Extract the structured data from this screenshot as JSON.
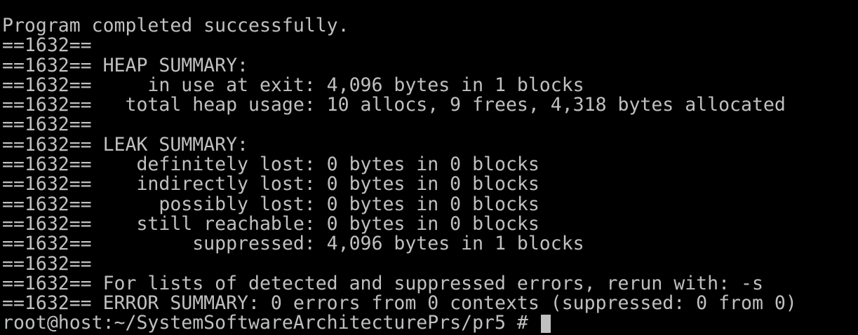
{
  "terminal": {
    "lines": [
      "Program completed successfully.",
      "==1632==",
      "==1632== HEAP SUMMARY:",
      "==1632==     in use at exit: 4,096 bytes in 1 blocks",
      "==1632==   total heap usage: 10 allocs, 9 frees, 4,318 bytes allocated",
      "==1632==",
      "==1632== LEAK SUMMARY:",
      "==1632==    definitely lost: 0 bytes in 0 blocks",
      "==1632==    indirectly lost: 0 bytes in 0 blocks",
      "==1632==      possibly lost: 0 bytes in 0 blocks",
      "==1632==    still reachable: 0 bytes in 0 blocks",
      "==1632==         suppressed: 4,096 bytes in 1 blocks",
      "==1632==",
      "==1632== For lists of detected and suppressed errors, rerun with: -s",
      "==1632== ERROR SUMMARY: 0 errors from 0 contexts (suppressed: 0 from 0)"
    ],
    "prompt": "root@host:~/SystemSoftwareArchitecturePrs/pr5 # "
  },
  "colors": {
    "background": "#000000",
    "text": "#c0c0c0",
    "cursor": "#c0c0c0"
  }
}
